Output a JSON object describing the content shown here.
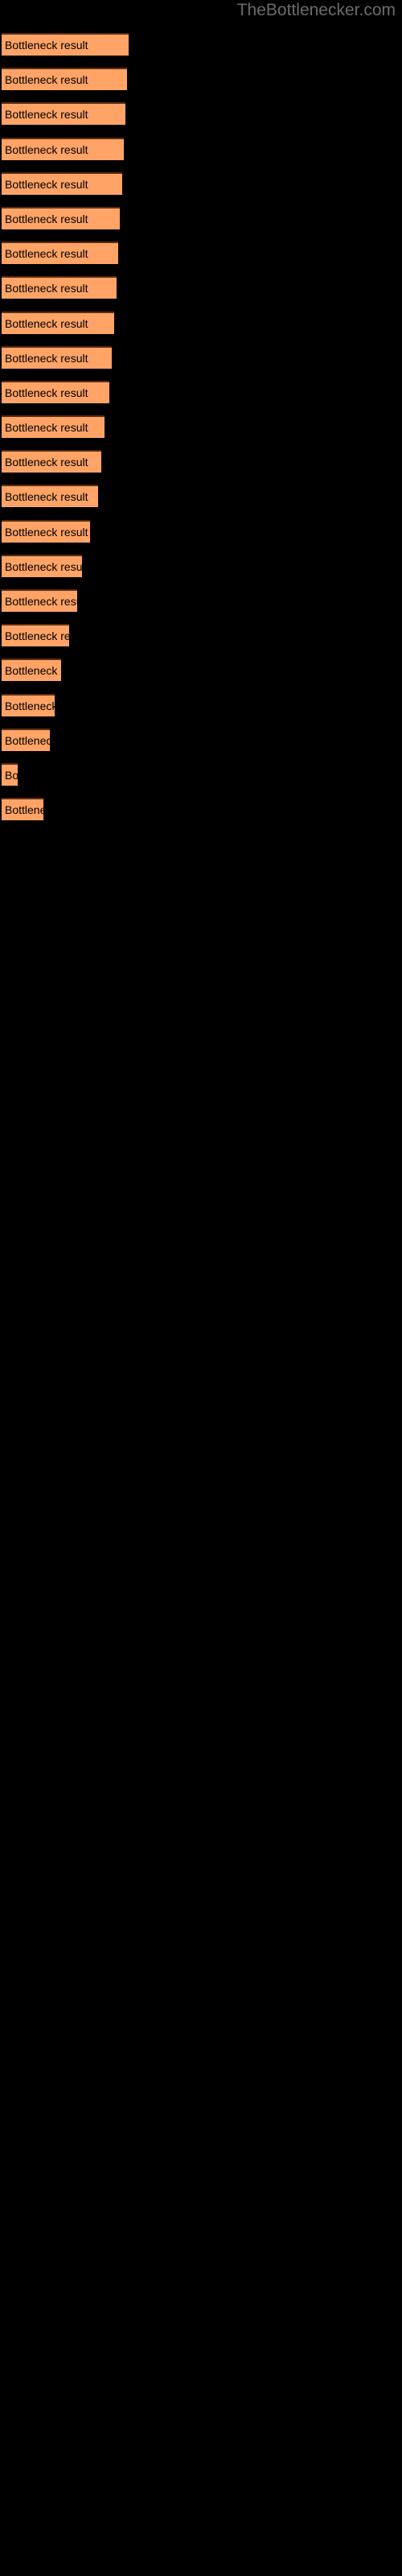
{
  "watermark": {
    "text": "TheBottlenecker.com",
    "color": "#6b6b6b"
  },
  "colors": {
    "background": "#000000",
    "bar_fill": "#ffa366",
    "bar_border_top": "#5c2e0e",
    "bar_label": "#000000",
    "watermark": "#6b6b6b"
  },
  "chart_data": {
    "type": "bar",
    "orientation": "horizontal",
    "title": "",
    "subtitle": "",
    "xlabel": "",
    "ylabel": "",
    "grid": false,
    "legend": null,
    "axis_visible": false,
    "tick_labels": [],
    "bar_label_text": "Bottleneck result",
    "categories": [
      "Bottleneck result",
      "Bottleneck result",
      "Bottleneck result",
      "Bottleneck result",
      "Bottleneck result",
      "Bottleneck result",
      "Bottleneck result",
      "Bottleneck result",
      "Bottleneck result",
      "Bottleneck result",
      "Bottleneck result",
      "Bottleneck result",
      "Bottleneck result",
      "Bottleneck result",
      "Bottleneck result",
      "Bottleneck result",
      "Bottleneck result",
      "Bottleneck result",
      "Bottleneck result",
      "Bottleneck result",
      "Bottleneck result",
      "Bottleneck result",
      "Bottleneck result"
    ],
    "values": [
      158,
      156,
      154,
      152,
      150,
      147,
      145,
      143,
      140,
      137,
      134,
      128,
      124,
      120,
      110,
      100,
      94,
      84,
      74,
      66,
      60,
      20,
      52
    ],
    "xlim": [
      0,
      500
    ],
    "bars": [
      {
        "label": "Bottleneck result",
        "value": 158,
        "visible_text": "Bottleneck result"
      },
      {
        "label": "Bottleneck result",
        "value": 156,
        "visible_text": "Bottleneck result"
      },
      {
        "label": "Bottleneck result",
        "value": 154,
        "visible_text": "Bottleneck result"
      },
      {
        "label": "Bottleneck result",
        "value": 152,
        "visible_text": "Bottleneck result"
      },
      {
        "label": "Bottleneck result",
        "value": 150,
        "visible_text": "Bottleneck result"
      },
      {
        "label": "Bottleneck result",
        "value": 147,
        "visible_text": "Bottleneck result"
      },
      {
        "label": "Bottleneck result",
        "value": 145,
        "visible_text": "Bottleneck result"
      },
      {
        "label": "Bottleneck result",
        "value": 143,
        "visible_text": "Bottleneck result"
      },
      {
        "label": "Bottleneck result",
        "value": 140,
        "visible_text": "Bottleneck result"
      },
      {
        "label": "Bottleneck result",
        "value": 137,
        "visible_text": "Bottleneck result"
      },
      {
        "label": "Bottleneck result",
        "value": 134,
        "visible_text": "Bottleneck result"
      },
      {
        "label": "Bottleneck result",
        "value": 128,
        "visible_text": "Bottleneck resu"
      },
      {
        "label": "Bottleneck result",
        "value": 124,
        "visible_text": "Bottleneck resu"
      },
      {
        "label": "Bottleneck result",
        "value": 120,
        "visible_text": "Bottleneck resu"
      },
      {
        "label": "Bottleneck result",
        "value": 110,
        "visible_text": "Bottleneck"
      },
      {
        "label": "Bottleneck result",
        "value": 100,
        "visible_text": "Bottlen"
      },
      {
        "label": "Bottleneck result",
        "value": 94,
        "visible_text": "Bottlenec"
      },
      {
        "label": "Bottleneck result",
        "value": 84,
        "visible_text": "Bottl"
      },
      {
        "label": "Bottleneck result",
        "value": 74,
        "visible_text": "B"
      },
      {
        "label": "Bottleneck result",
        "value": 66,
        "visible_text": "Bottle"
      },
      {
        "label": "Bottleneck result",
        "value": 60,
        "visible_text": "Bot"
      },
      {
        "label": "Bottleneck result",
        "value": 20,
        "visible_text": ""
      },
      {
        "label": "Bottleneck result",
        "value": 52,
        "visible_text": "Bott"
      }
    ]
  }
}
